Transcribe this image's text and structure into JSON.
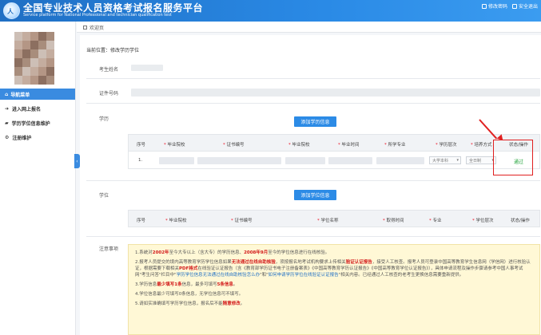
{
  "header": {
    "title": "全国专业技术人员资格考试报名服务平台",
    "subtitle": "Service platform for National Professional and technician qualification test",
    "links": [
      "修改密码",
      "安全退出"
    ]
  },
  "sidebar": {
    "nav_head": "导航菜单",
    "items": [
      "进入网上报名",
      "学历学位信息维护",
      "注册维护"
    ]
  },
  "tabs": [
    "欢迎页"
  ],
  "breadcrumb": "当前位置：修改学历学位",
  "form": {
    "name_label": "考生姓名",
    "id_label": "证件号码",
    "education_label": "学历",
    "degree_label": "学位",
    "notice_label": "注意事项"
  },
  "buttons": {
    "add_education": "添加学历信息",
    "add_degree": "添加学位信息"
  },
  "education_table": {
    "headers": [
      "序号",
      "毕业院校",
      "证书编号",
      "毕业院校",
      "毕业时间",
      "所学专业",
      "学历层次",
      "培养方式",
      "状态/操作"
    ],
    "required": [
      false,
      true,
      true,
      true,
      true,
      true,
      true,
      true,
      false
    ],
    "rows": [
      {
        "index": "1.",
        "level": "大学本科",
        "mode": "全日制",
        "status": "通过"
      }
    ]
  },
  "degree_table": {
    "headers": [
      "序号",
      "毕业院校",
      "证书编号",
      "学位名称",
      "取得时间",
      "专业",
      "学位层次",
      "状态/操作"
    ],
    "required": [
      false,
      true,
      true,
      true,
      true,
      true,
      true,
      false
    ]
  },
  "notice": {
    "p1_a": "1.系统对",
    "p1_b": "2002年",
    "p1_c": "至今大专以上（含大专）的学历信息、",
    "p1_d": "2008年9月",
    "p1_e": "至今的学位信息进行在线核验。",
    "p2_a": "2.报考人员提交的境内高等教育学历学位信息如果",
    "p2_b": "无法通过在线自助核验",
    "p2_c": "，须按报名地考试机构要求上传相关",
    "p2_d": "验证认证报告",
    "p2_e": "，接受人工核查。报考人员可登录中国高等教育学生信息网（学信网）进行核验认证，根据需要下载相关",
    "p2_f": "PDF格式",
    "p2_g": "在线验证认证报告（含《教育部学历证书电子注册备案表》《中国高等教育学历认证报告》《中国高等教育学位认证报告》），具体申请流程及操作步骤请参考中国人事考试网\"考生问答\"栏目中\"",
    "p2_h": "学历学位信息无法通过在线自助核验怎么办",
    "p2_i": "\"和\"",
    "p2_j": "如何申请学历学位在线验证认证报告",
    "p2_k": "\"相关内容。已经通过人工核查的老考生更换信息需要重新提供。",
    "p3_a": "3.学历信息",
    "p3_b": "最少填写1条",
    "p3_c": "信息，最多可填写",
    "p3_d": "5条信息",
    "p3_e": "。",
    "p4": "4.学位信息最少可填写0条信息，无学位信息可不填写。",
    "p5_a": "5.请如实准确填写学历学位信息，报名后不能",
    "p5_b": "随意修改",
    "p5_c": "。"
  }
}
